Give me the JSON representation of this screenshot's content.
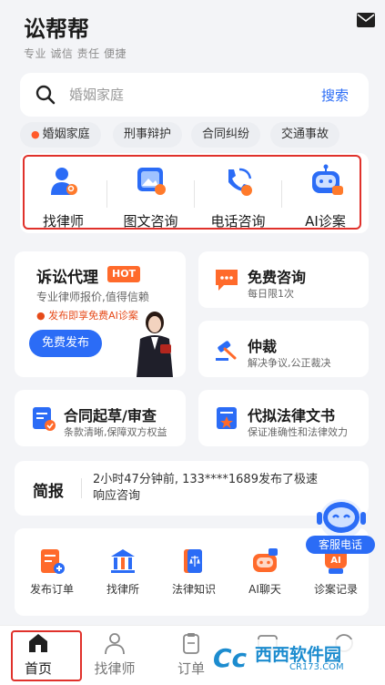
{
  "header": {
    "logo": "讼帮帮",
    "slogan": "专业 诚信 责任 便捷"
  },
  "search": {
    "placeholder": "婚姻家庭",
    "button": "搜索"
  },
  "tags": [
    "婚姻家庭",
    "刑事辩护",
    "合同纠纷",
    "交通事故"
  ],
  "services": [
    {
      "label": "找律师",
      "icon": "lawyer-search-icon"
    },
    {
      "label": "图文咨询",
      "icon": "image-consult-icon"
    },
    {
      "label": "电话咨询",
      "icon": "phone-consult-icon"
    },
    {
      "label": "AI诊案",
      "icon": "ai-robot-icon"
    }
  ],
  "litigation": {
    "title": "诉讼代理",
    "badge": "HOT",
    "subtitle": "专业律师报价,值得信赖",
    "promo": "发布即享免费AI诊案",
    "button": "免费发布"
  },
  "free_consult": {
    "title": "免费咨询",
    "subtitle": "每日限1次"
  },
  "arbitration": {
    "title": "仲裁",
    "subtitle": "解决争议,公正裁决"
  },
  "contract": {
    "title": "合同起草/审查",
    "subtitle": "条款清晰,保障双方权益"
  },
  "documents": {
    "title": "代拟法律文书",
    "subtitle": "保证准确性和法律效力"
  },
  "news": {
    "tag": "简报",
    "text": "2小时47分钟前, 133****1689发布了极速响应咨询"
  },
  "quick": [
    {
      "label": "发布订单",
      "icon": "publish-order-icon"
    },
    {
      "label": "找律所",
      "icon": "law-firm-icon"
    },
    {
      "label": "法律知识",
      "icon": "law-book-icon"
    },
    {
      "label": "AI聊天",
      "icon": "ai-chat-icon"
    },
    {
      "label": "诊案记录",
      "icon": "case-record-icon"
    }
  ],
  "customer_service": "客服电话",
  "tabbar": [
    {
      "label": "首页",
      "active": true
    },
    {
      "label": "找律师",
      "active": false
    },
    {
      "label": "订单",
      "active": false
    },
    {
      "label": "",
      "active": false
    },
    {
      "label": "",
      "active": false
    }
  ],
  "watermark": {
    "name": "西西软件园",
    "url": "CR173.COM"
  },
  "colors": {
    "accent": "#2b6cf6",
    "highlight": "#e0312b",
    "hot": "#ff6a2b"
  }
}
